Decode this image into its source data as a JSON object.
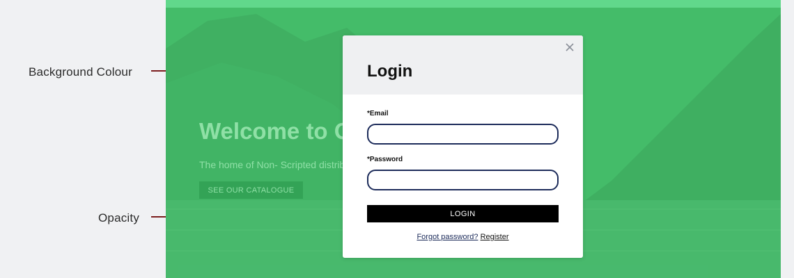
{
  "annotations": {
    "background_colour": "Background Colour",
    "opacity": "Opacity"
  },
  "hero": {
    "title": "Welcome to O",
    "subtitle": "The home of Non- Scripted distrib",
    "button_label": "SEE OUR CATALOGUE"
  },
  "modal": {
    "title": "Login",
    "email_label": "*Email",
    "email_value": "",
    "password_label": "*Password",
    "password_value": "",
    "login_label": "LOGIN",
    "forgot_label": "Forgot password?",
    "register_label": "Register",
    "close_icon": "close-icon"
  },
  "colors": {
    "overlay_green": "#46c46e",
    "topbar_green": "#61d88b",
    "field_border": "#1c2b5a",
    "annotation_line": "#7a1c1c"
  }
}
